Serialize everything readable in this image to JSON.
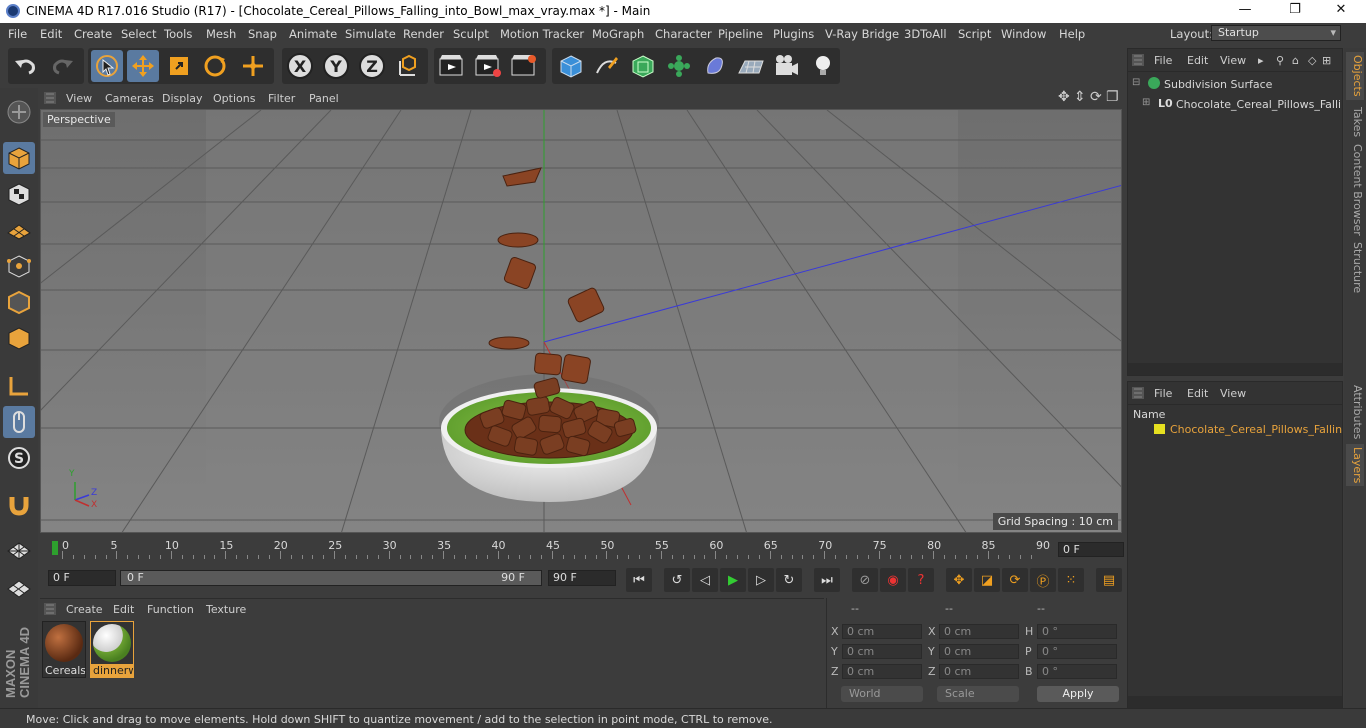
{
  "window": {
    "title": "CINEMA 4D R17.016 Studio (R17) - [Chocolate_Cereal_Pillows_Falling_into_Bowl_max_vray.max *] - Main",
    "minimize": "—",
    "restore": "❐",
    "close": "✕"
  },
  "menu": [
    "File",
    "Edit",
    "Create",
    "Select",
    "Tools",
    "Mesh",
    "Snap",
    "Animate",
    "Simulate",
    "Render",
    "Sculpt",
    "Motion Tracker",
    "MoGraph",
    "Character",
    "Pipeline",
    "Plugins",
    "V-Ray Bridge",
    "3DToAll",
    "Script",
    "Window",
    "Help"
  ],
  "layout": {
    "label": "Layout:",
    "value": "Startup"
  },
  "viewport_menu": [
    "View",
    "Cameras",
    "Display",
    "Options",
    "Filter",
    "Panel"
  ],
  "viewport": {
    "camera": "Perspective",
    "grid_spacing": "Grid Spacing : 10 cm",
    "axis_x": "X",
    "axis_y": "Y",
    "axis_z": "Z"
  },
  "timeline": {
    "ticks": [
      "0",
      "5",
      "10",
      "15",
      "20",
      "25",
      "30",
      "35",
      "40",
      "45",
      "50",
      "55",
      "60",
      "65",
      "70",
      "75",
      "80",
      "85",
      "90"
    ],
    "current_frame": "0 F",
    "start_field": "0 F",
    "range_start": "0 F",
    "range_end": "90 F",
    "end_field": "90 F"
  },
  "material_menu": [
    "Create",
    "Edit",
    "Function",
    "Texture"
  ],
  "materials": [
    {
      "name": "Cereals_"
    },
    {
      "name": "dinnerw"
    }
  ],
  "coords": {
    "headers": [
      "--",
      "--",
      "--"
    ],
    "rows": [
      {
        "a": "X",
        "av": "0 cm",
        "b": "X",
        "bv": "0 cm",
        "c": "H",
        "cv": "0 °"
      },
      {
        "a": "Y",
        "av": "0 cm",
        "b": "Y",
        "bv": "0 cm",
        "c": "P",
        "cv": "0 °"
      },
      {
        "a": "Z",
        "av": "0 cm",
        "b": "Z",
        "bv": "0 cm",
        "c": "B",
        "cv": "0 °"
      }
    ],
    "space": "World",
    "mode": "Scale",
    "apply": "Apply"
  },
  "objects_menu": [
    "File",
    "Edit",
    "View"
  ],
  "objects": [
    {
      "name": "Subdivision Surface"
    },
    {
      "name": "Chocolate_Cereal_Pillows_Falling"
    }
  ],
  "layers_menu": [
    "File",
    "Edit",
    "View"
  ],
  "layers": {
    "header": "Name",
    "items": [
      "Chocolate_Cereal_Pillows_Falling_"
    ]
  },
  "right_tabs": [
    "Objects",
    "Takes",
    "Content Browser",
    "Structure",
    "Attributes",
    "Layers"
  ],
  "brand": "MAXON CINEMA 4D",
  "status": "Move: Click and drag to move elements. Hold down SHIFT to quantize movement / add to the selection in point mode, CTRL to remove."
}
